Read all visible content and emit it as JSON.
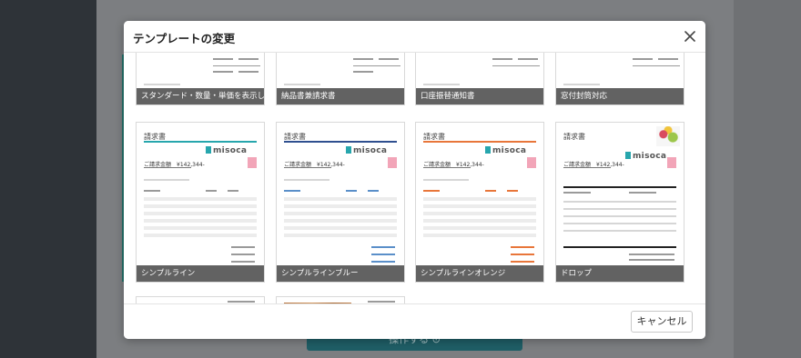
{
  "modal": {
    "title": "テンプレートの変更",
    "close_icon": "close-icon",
    "cancel_label": "キャンセル"
  },
  "background": {
    "action_label": "操作する ⊙"
  },
  "templates": [
    {
      "name": "スタンダード・数量・単価を表示しない"
    },
    {
      "name": "納品書兼請求書"
    },
    {
      "name": "口座振替通知書"
    },
    {
      "name": "窓付封筒対応"
    },
    {
      "name": "シンプルライン",
      "accent": "#27a6ad"
    },
    {
      "name": "シンプルラインブルー",
      "accent": "#2f4f8f"
    },
    {
      "name": "シンプルラインオレンジ",
      "accent": "#e8763a"
    },
    {
      "name": "ドロップ",
      "accent": "#222222"
    },
    {
      "name": "",
      "accent": "#27a6ad"
    },
    {
      "name": "",
      "accent": "#b8733b"
    }
  ],
  "doc": {
    "title": "請求書",
    "logo": "misoca",
    "amount": "ご請求金額　¥142,344-"
  }
}
